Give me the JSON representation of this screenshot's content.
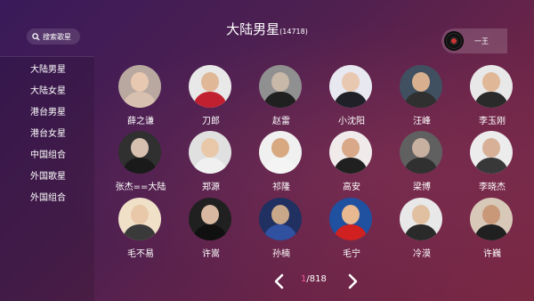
{
  "search": {
    "label": "搜索歌星",
    "icon": "search-icon"
  },
  "header": {
    "title": "大陆男星",
    "count": "(14718)"
  },
  "now_playing": {
    "text": "一王",
    "icon": "vinyl-disc-icon"
  },
  "sidebar": {
    "items": [
      {
        "label": "大陆男星"
      },
      {
        "label": "大陆女星"
      },
      {
        "label": "港台男星"
      },
      {
        "label": "港台女星"
      },
      {
        "label": "中国组合"
      },
      {
        "label": "外国歌星"
      },
      {
        "label": "外国组合"
      }
    ]
  },
  "singers": [
    {
      "name": "薛之谦",
      "bg": "#b8a8a0",
      "skin": "#e8c8b0",
      "shirt": "#d8c0b0"
    },
    {
      "name": "刀郎",
      "bg": "#e8e8e8",
      "skin": "#e0b898",
      "shirt": "#c02030"
    },
    {
      "name": "赵雷",
      "bg": "#909090",
      "skin": "#c8b8a8",
      "shirt": "#202020"
    },
    {
      "name": "小沈阳",
      "bg": "#e8e8f0",
      "skin": "#e8c8b0",
      "shirt": "#202028"
    },
    {
      "name": "汪峰",
      "bg": "#405060",
      "skin": "#d8b090",
      "shirt": "#303030"
    },
    {
      "name": "李玉刚",
      "bg": "#e8e8e8",
      "skin": "#e0b898",
      "shirt": "#2a2a2a"
    },
    {
      "name": "张杰==大陆",
      "bg": "#303030",
      "skin": "#d8c0b0",
      "shirt": "#1a1a1a"
    },
    {
      "name": "郑源",
      "bg": "#e0e0e0",
      "skin": "#e8c8a8",
      "shirt": "#f0f0f0"
    },
    {
      "name": "祁隆",
      "bg": "#f0f0f0",
      "skin": "#d8a880",
      "shirt": "#f4f4f4"
    },
    {
      "name": "高安",
      "bg": "#f0eaea",
      "skin": "#d8a888",
      "shirt": "#202020"
    },
    {
      "name": "梁博",
      "bg": "#606060",
      "skin": "#c8b0a0",
      "shirt": "#303030"
    },
    {
      "name": "李晓杰",
      "bg": "#ececec",
      "skin": "#d8b098",
      "shirt": "#383838"
    },
    {
      "name": "毛不易",
      "bg": "#f0e0c8",
      "skin": "#e8c8a8",
      "shirt": "#3a3a3a"
    },
    {
      "name": "许嵩",
      "bg": "#202020",
      "skin": "#d8b8a0",
      "shirt": "#101010"
    },
    {
      "name": "孙楠",
      "bg": "#203060",
      "skin": "#c8a888",
      "shirt": "#3050a0"
    },
    {
      "name": "毛宁",
      "bg": "#2050a0",
      "skin": "#e8b890",
      "shirt": "#d02020"
    },
    {
      "name": "冷漠",
      "bg": "#e8e8e8",
      "skin": "#e0c0a0",
      "shirt": "#2a2a2a"
    },
    {
      "name": "许巍",
      "bg": "#d8c8b8",
      "skin": "#c89878",
      "shirt": "#202020"
    }
  ],
  "pagination": {
    "current": "1",
    "total": "/818",
    "prev_icon": "chevron-left-icon",
    "next_icon": "chevron-right-icon"
  }
}
